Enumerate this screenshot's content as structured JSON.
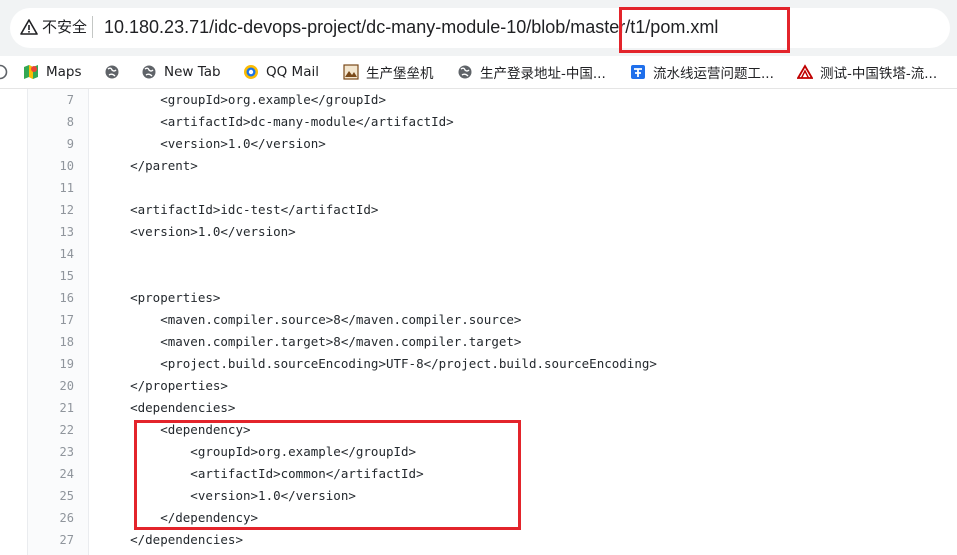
{
  "browser": {
    "security_label": "不安全",
    "url_host": "10.180.23.71",
    "url_path": "/idc-devops-project/dc-many-module-10/blob/master/t1/pom.xml",
    "warning_color": "#202124",
    "highlight_color": "#e3242b"
  },
  "bookmarks": [
    {
      "label": "Maps",
      "icon": "maps-icon",
      "color": "#34a853"
    },
    {
      "label": "",
      "icon": "globe-icon",
      "color": "#5f6368"
    },
    {
      "label": "New Tab",
      "icon": "globe-icon",
      "color": "#5f6368"
    },
    {
      "label": "QQ Mail",
      "icon": "qq-mail-icon",
      "color": "#1a73e8"
    },
    {
      "label": "生产堡垒机",
      "icon": "image-icon",
      "color": "#7a4a1a"
    },
    {
      "label": "生产登录地址-中国...",
      "icon": "globe-icon",
      "color": "#5f6368"
    },
    {
      "label": "流水线运营问题工...",
      "icon": "feishu-icon",
      "color": "#1f6feb"
    },
    {
      "label": "测试-中国铁塔-流...",
      "icon": "tower-icon",
      "color": "#c00000"
    }
  ],
  "code": {
    "lines": [
      {
        "n": "7",
        "text": "        <groupId>org.example</groupId>"
      },
      {
        "n": "8",
        "text": "        <artifactId>dc-many-module</artifactId>"
      },
      {
        "n": "9",
        "text": "        <version>1.0</version>"
      },
      {
        "n": "10",
        "text": "    </parent>"
      },
      {
        "n": "11",
        "text": ""
      },
      {
        "n": "12",
        "text": "    <artifactId>idc-test</artifactId>"
      },
      {
        "n": "13",
        "text": "    <version>1.0</version>"
      },
      {
        "n": "14",
        "text": ""
      },
      {
        "n": "15",
        "text": ""
      },
      {
        "n": "16",
        "text": "    <properties>"
      },
      {
        "n": "17",
        "text": "        <maven.compiler.source>8</maven.compiler.source>"
      },
      {
        "n": "18",
        "text": "        <maven.compiler.target>8</maven.compiler.target>"
      },
      {
        "n": "19",
        "text": "        <project.build.sourceEncoding>UTF-8</project.build.sourceEncoding>"
      },
      {
        "n": "20",
        "text": "    </properties>"
      },
      {
        "n": "21",
        "text": "    <dependencies>"
      },
      {
        "n": "22",
        "text": "        <dependency>"
      },
      {
        "n": "23",
        "text": "            <groupId>org.example</groupId>"
      },
      {
        "n": "24",
        "text": "            <artifactId>common</artifactId>"
      },
      {
        "n": "25",
        "text": "            <version>1.0</version>"
      },
      {
        "n": "26",
        "text": "        </dependency>"
      },
      {
        "n": "27",
        "text": "    </dependencies>"
      }
    ]
  }
}
